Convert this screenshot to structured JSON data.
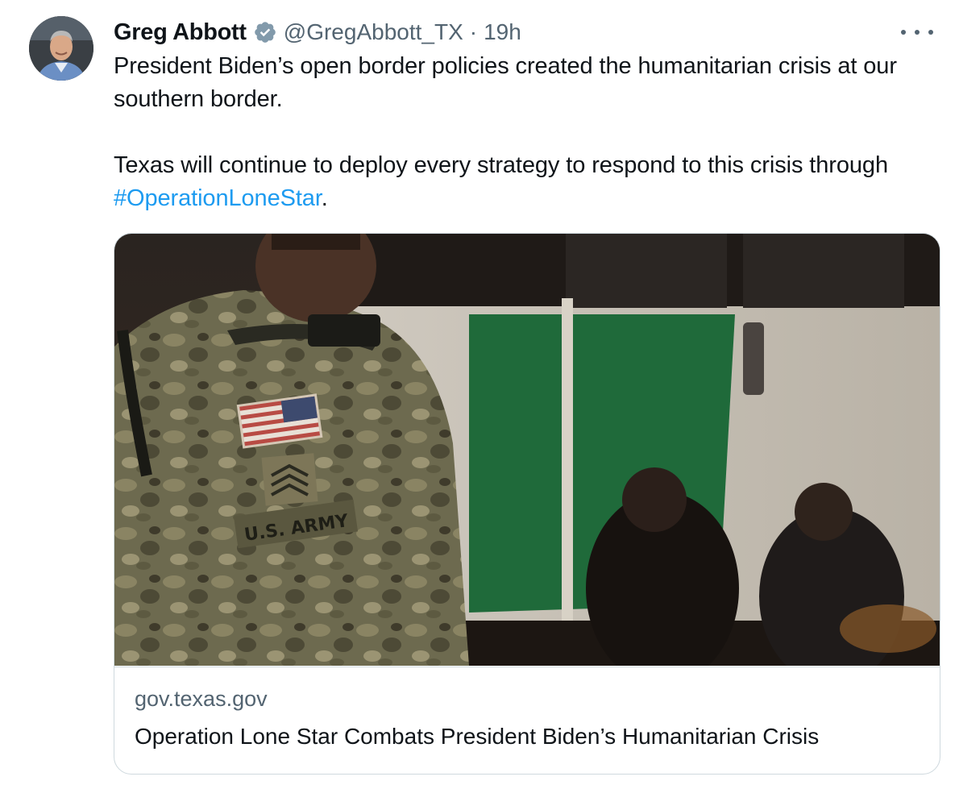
{
  "author": {
    "name": "Greg Abbott",
    "handle": "@GregAbbott_TX",
    "separator": "·",
    "time": "19h"
  },
  "tweet": {
    "paragraph1": "President Biden’s open border policies created the humanitarian crisis at our southern border.",
    "paragraph2_prefix": "Texas will continue to deploy every strategy to respond to this crisis through ",
    "hashtag": "#OperationLoneStar",
    "paragraph2_suffix": "."
  },
  "card": {
    "domain": "gov.texas.gov",
    "title": "Operation Lone Star Combats President Biden’s Humanitarian Crisis",
    "image_patch_text": "U.S. ARMY"
  },
  "colors": {
    "accent": "#1d9bf0",
    "secondary_text": "#536471",
    "border": "#cfd9de"
  },
  "icons": [
    "avatar",
    "verified-badge-icon",
    "more-options-icon"
  ]
}
